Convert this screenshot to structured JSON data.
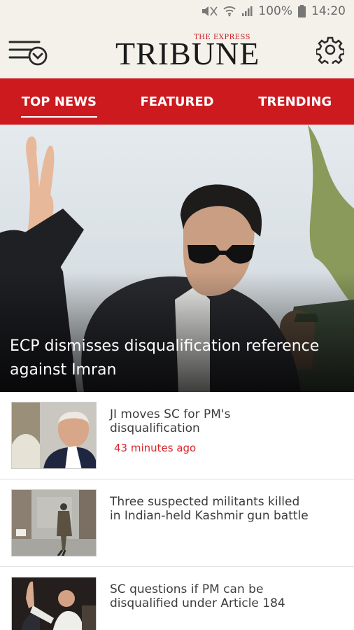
{
  "status_bar": {
    "battery": "100%",
    "time": "14:20",
    "icons": [
      "mute-icon",
      "wifi-icon",
      "signal-icon",
      "battery-icon"
    ]
  },
  "app_bar": {
    "logo_small": "THE EXPRESS",
    "logo_big": "TRIBUNE"
  },
  "tabs": [
    {
      "label": "TOP NEWS",
      "active": true
    },
    {
      "label": "FEATURED",
      "active": false
    },
    {
      "label": "TRENDING",
      "active": false
    }
  ],
  "hero": {
    "headline": "ECP dismisses disqualification reference against Imran"
  },
  "articles": [
    {
      "title": "JI moves SC for PM's disqualification",
      "time": "43 minutes ago"
    },
    {
      "title": "Three suspected militants killed in Indian-held Kashmir gun battle",
      "time": ""
    },
    {
      "title": "SC questions if PM can be disqualified under Article 184",
      "time": ""
    }
  ],
  "colors": {
    "brand_red": "#cc1a1f",
    "app_bar_bg": "#f3f1ea",
    "time_red": "#d9262c"
  }
}
